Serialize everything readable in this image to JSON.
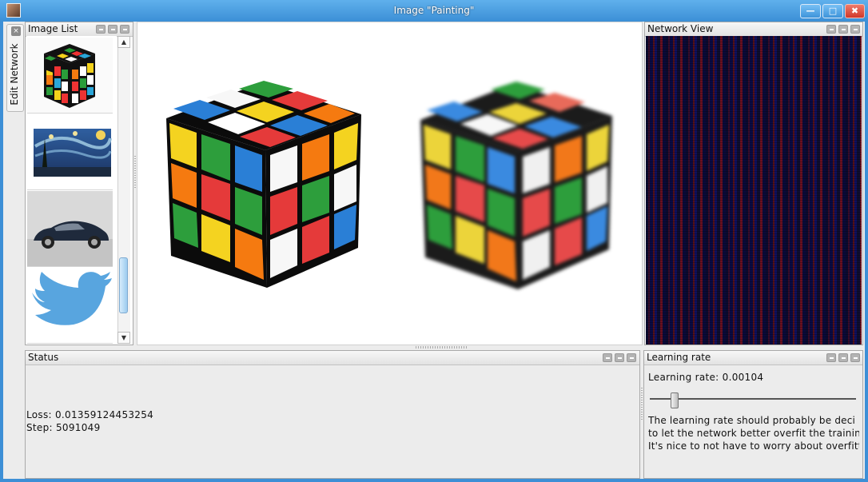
{
  "window": {
    "title": "Image \"Painting\"",
    "minimize_icon": "minimize-icon",
    "maximize_icon": "maximize-icon",
    "close_icon": "close-icon"
  },
  "side_tab": {
    "label": "Edit Network"
  },
  "image_list": {
    "title": "Image List",
    "thumbnails": [
      "rubiks-cube-thumbnail",
      "starry-night-thumbnail",
      "car-thumbnail",
      "twitter-bird-thumbnail"
    ]
  },
  "network_view": {
    "title": "Network View"
  },
  "status": {
    "title": "Status",
    "loss": "Loss: 0.01359124453254",
    "step": "Step: 5091049"
  },
  "learning_rate": {
    "title": "Learning rate",
    "value_text": "Learning rate: 0.00104",
    "slider_value": 0.12,
    "description": [
      "The learning rate should probably be deci",
      "to let the network better overfit the training",
      "It's nice to not have to worry about overfitti"
    ]
  },
  "colors": {
    "title_bar": "#3b8fd6",
    "close_button": "#d0382a",
    "panel_bg": "#ececec"
  }
}
